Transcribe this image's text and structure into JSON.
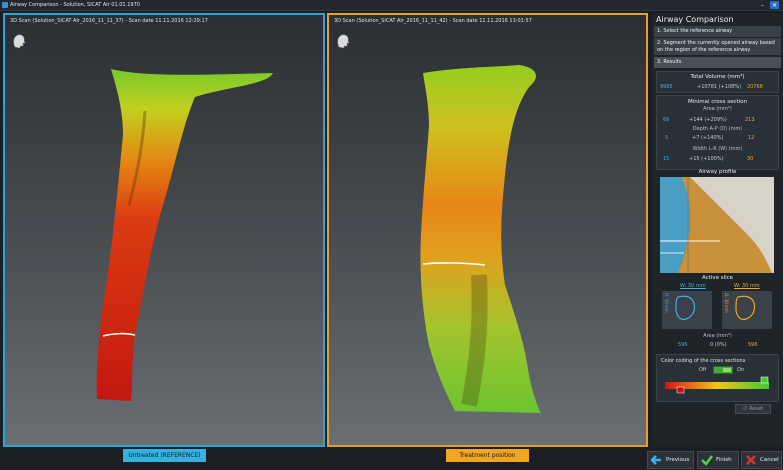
{
  "window": {
    "title": "Airway Comparison - Solution, SICAT Air 01.01.1970",
    "minimize": "–",
    "close": "✕"
  },
  "viewports": {
    "left": {
      "header": "3D Scan (Solution_SICAT Air_2016_11_11_37) - Scan date 11.11.2016 12:29:17",
      "tag": "Untreated (REFERENCE)",
      "color": "#2aa6d6"
    },
    "right": {
      "header": "3D Scan (Solution_SICAT Air_2016_11_11_42) - Scan date 11.11.2016 13:01:57",
      "tag": "Treatment position",
      "color": "#e3a12b"
    }
  },
  "panel": {
    "title": "Airway Comparison",
    "steps": [
      "1. Select the reference airway",
      "2. Segment the currently opened airway based on the region of the reference airway",
      "3. Results"
    ],
    "total_volume": {
      "label": "Total Volume (mm³)",
      "ref": "9985",
      "diff": "+10781 (+108%)",
      "cur": "20766"
    },
    "minimal_cross_section": {
      "label": "Minimal cross section",
      "area_label": "Area (mm²)",
      "area_ref": "69",
      "area_diff": "+144 (+209%)",
      "area_cur": "213",
      "depth_label": "Depth A-P (D) (mm)",
      "depth_ref": "5",
      "depth_diff": "+7 (+140%)",
      "depth_cur": "12",
      "width_label": "Width L-R (W) (mm)",
      "width_ref": "15",
      "width_diff": "+15 (+100%)",
      "width_cur": "30"
    },
    "airway_profile": {
      "label": "Airway profile"
    },
    "active_slice": {
      "label": "Active slice",
      "w_left": "W: 30 mm",
      "w_right": "W: 30 mm",
      "d_left": "D: 30 mm",
      "d_right": "D: 30 mm",
      "area_label": "Area (mm²)",
      "area_ref": "596",
      "area_diff": "0 (0%)",
      "area_cur": "596"
    },
    "color_coding": {
      "label": "Color coding of the cross sections",
      "off": "Off",
      "on": "On",
      "reset": "Reset"
    }
  },
  "buttons": {
    "previous": "Previous",
    "finish": "Finish",
    "cancel": "Cancel"
  }
}
